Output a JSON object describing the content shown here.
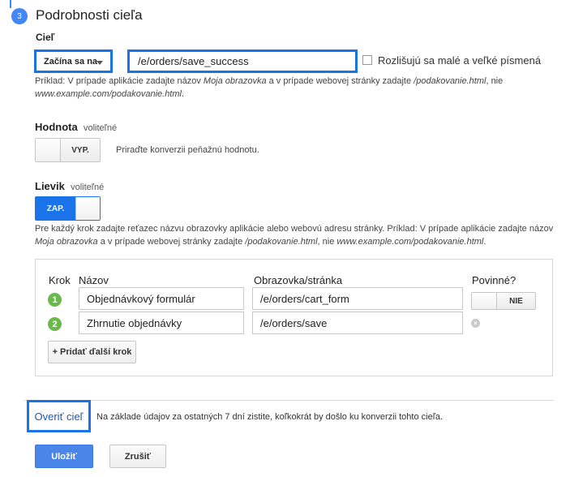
{
  "step": {
    "number": "3",
    "title": "Podrobnosti cieľa"
  },
  "goal": {
    "label": "Cieľ",
    "match_type": "Začína sa na",
    "url_value": "/e/orders/save_success",
    "case_sensitive_label": "Rozlišujú sa malé a veľké písmená",
    "case_sensitive_checked": false,
    "help": {
      "p1": "Príklad: V prípade aplikácie zadajte názov ",
      "app_example": "Moja obrazovka",
      "p2": " a v prípade webovej stránky zadajte ",
      "page_example": "/podakovanie.html",
      "p3": ", nie",
      "url_example": "www.example.com/podakovanie.html",
      "p4": "."
    }
  },
  "value": {
    "label": "Hodnota",
    "optional": "voliteľné",
    "toggle_label": "VYP.",
    "toggle_on": false,
    "description": "Priraďte konverzii peňažnú hodnotu."
  },
  "funnel": {
    "label": "Lievik",
    "optional": "voliteľné",
    "toggle_label": "ZAP.",
    "toggle_on": true,
    "help": {
      "p1": "Pre každý krok zadajte reťazec názvu obrazovky aplikácie alebo webovú adresu stránky. Príklad: V prípade aplikácie zadajte názov",
      "app_example": "Moja obrazovka",
      "p2": " a v prípade webovej stránky zadajte ",
      "page_example": "/podakovanie.html",
      "p3": ", nie ",
      "url_example": "www.example.com/podakovanie.html",
      "p4": "."
    },
    "columns": {
      "step": "Krok",
      "name": "Názov",
      "screen": "Obrazovka/stránka",
      "required": "Povinné?"
    },
    "rows": [
      {
        "num": "1",
        "name": "Objednávkový formulár",
        "screen": "/e/orders/cart_form",
        "required_label": "NIE"
      },
      {
        "num": "2",
        "name": "Zhrnutie objednávky",
        "screen": "/e/orders/save"
      }
    ],
    "add_step_label": "+ Pridať ďalší krok"
  },
  "verify": {
    "label": "Overiť cieľ",
    "description": "Na základe údajov za ostatných 7 dní zistite, koľkokrát by došlo ku konverzii tohto cieľa."
  },
  "actions": {
    "save": "Uložiť",
    "cancel": "Zrušiť"
  },
  "colors": {
    "accent": "#1a73e8",
    "step_green": "#6ab94a",
    "primary_button": "#4a86e8"
  }
}
